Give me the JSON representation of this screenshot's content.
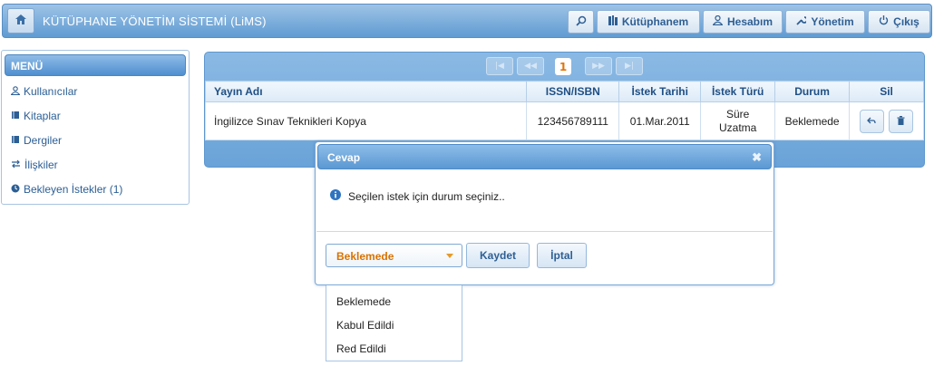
{
  "header": {
    "title": "KÜTÜPHANE YÖNETİM SİSTEMİ (LiMS)",
    "buttons": {
      "kutuphanem": "Kütüphanem",
      "hesabim": "Hesabım",
      "yonetim": "Yönetim",
      "cikis": "Çıkış"
    }
  },
  "sidebar": {
    "heading": "MENÜ",
    "items": [
      {
        "label": "Kullanıcılar",
        "icon": "users-icon"
      },
      {
        "label": "Kitaplar",
        "icon": "book-icon"
      },
      {
        "label": "Dergiler",
        "icon": "magazine-icon"
      },
      {
        "label": "İlişkiler",
        "icon": "relations-icon"
      },
      {
        "label": "Bekleyen İstekler (1)",
        "icon": "clock-icon"
      }
    ]
  },
  "pager": {
    "current_page": "1"
  },
  "table": {
    "columns": [
      "Yayın Adı",
      "ISSN/ISBN",
      "İstek Tarihi",
      "İstek Türü",
      "Durum",
      "Sil"
    ],
    "rows": [
      {
        "yayin_adi": "İngilizce Sınav Teknikleri Kopya",
        "issn": "123456789111",
        "tarih": "01.Mar.2011",
        "tur": "Süre Uzatma",
        "durum": "Beklemede"
      }
    ]
  },
  "dialog": {
    "title": "Cevap",
    "message": "Seçilen istek için durum seçiniz..",
    "select_value": "Beklemede",
    "save_label": "Kaydet",
    "cancel_label": "İptal",
    "options": [
      "Beklemede",
      "Kabul Edildi",
      "Red Edildi"
    ]
  },
  "colors": {
    "accent": "#5f9bd2",
    "select_text": "#d97200",
    "link": "#2b5e95"
  }
}
